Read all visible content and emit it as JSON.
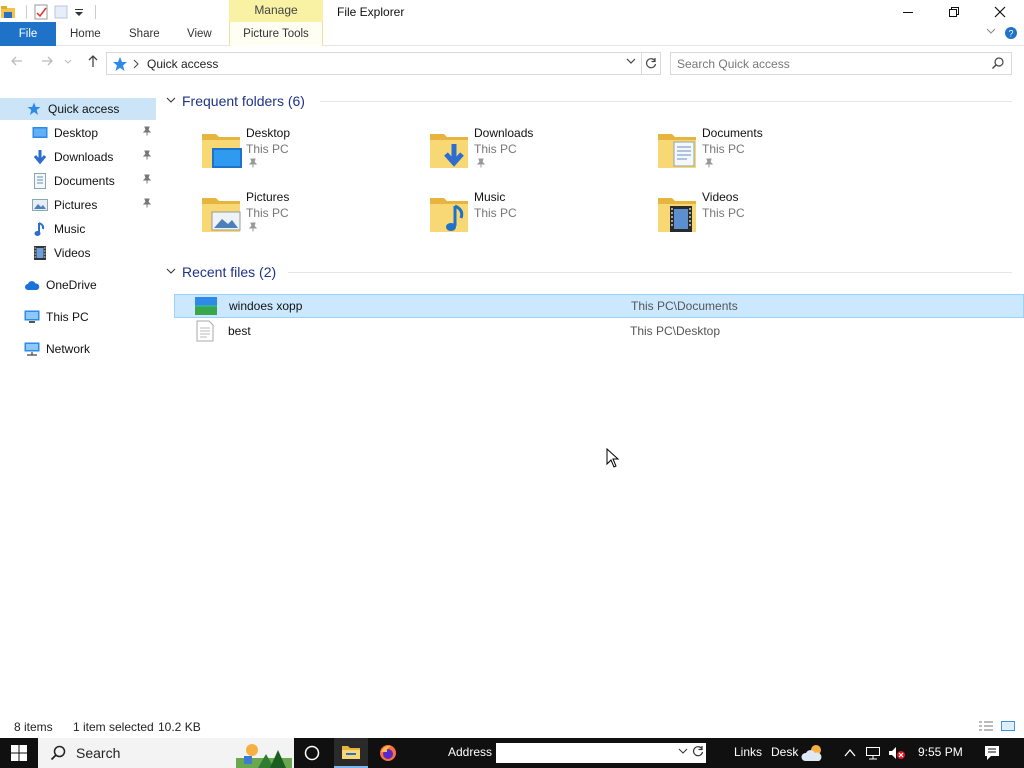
{
  "window": {
    "title": "File Explorer",
    "context_tab_group": "Manage",
    "controls": {
      "minimize": "—",
      "restore": "❐",
      "close": "✕"
    }
  },
  "ribbon": {
    "tabs": [
      {
        "label": "File"
      },
      {
        "label": "Home"
      },
      {
        "label": "Share"
      },
      {
        "label": "View"
      },
      {
        "label": "Picture Tools"
      }
    ],
    "accent_color": "#1e73c8",
    "context_color": "#f9f2a5"
  },
  "address": {
    "breadcrumb": "Quick access",
    "search_placeholder": "Search Quick access"
  },
  "navigation": {
    "items": [
      {
        "label": "Quick access",
        "icon": "star-icon",
        "pinned": false
      },
      {
        "label": "Desktop",
        "icon": "desktop-icon",
        "pinned": true
      },
      {
        "label": "Downloads",
        "icon": "download-icon",
        "pinned": true
      },
      {
        "label": "Documents",
        "icon": "documents-icon",
        "pinned": true
      },
      {
        "label": "Pictures",
        "icon": "pictures-icon",
        "pinned": true
      },
      {
        "label": "Music",
        "icon": "music-icon",
        "pinned": false
      },
      {
        "label": "Videos",
        "icon": "videos-icon",
        "pinned": false
      },
      {
        "label": "OneDrive",
        "icon": "cloud-icon",
        "pinned": false
      },
      {
        "label": "This PC",
        "icon": "computer-icon",
        "pinned": false
      },
      {
        "label": "Network",
        "icon": "network-icon",
        "pinned": false
      }
    ],
    "pin_glyph": "📌"
  },
  "frequent_folders": {
    "header": "Frequent folders (6)",
    "items": [
      {
        "name": "Desktop",
        "location": "This PC",
        "pinned": true,
        "icon": "desktop-folder-icon"
      },
      {
        "name": "Downloads",
        "location": "This PC",
        "pinned": true,
        "icon": "downloads-folder-icon"
      },
      {
        "name": "Documents",
        "location": "This PC",
        "pinned": true,
        "icon": "documents-folder-icon"
      },
      {
        "name": "Pictures",
        "location": "This PC",
        "pinned": true,
        "icon": "pictures-folder-icon"
      },
      {
        "name": "Music",
        "location": "This PC",
        "pinned": false,
        "icon": "music-folder-icon"
      },
      {
        "name": "Videos",
        "location": "This PC",
        "pinned": false,
        "icon": "videos-folder-icon"
      }
    ]
  },
  "recent_files": {
    "header": "Recent files (2)",
    "items": [
      {
        "name": "windoes xopp",
        "path": "This PC\\Documents",
        "selected": true,
        "icon": "image-file-icon"
      },
      {
        "name": "best",
        "path": "This PC\\Desktop",
        "selected": false,
        "icon": "text-file-icon"
      }
    ]
  },
  "status": {
    "item_count": "8 items",
    "selection": "1 item selected",
    "size": "10.2 KB"
  },
  "taskbar": {
    "search_label": "Search",
    "address_label": "Address",
    "links_label": "Links",
    "desk_label": "Desk",
    "time": "9:55 PM"
  }
}
